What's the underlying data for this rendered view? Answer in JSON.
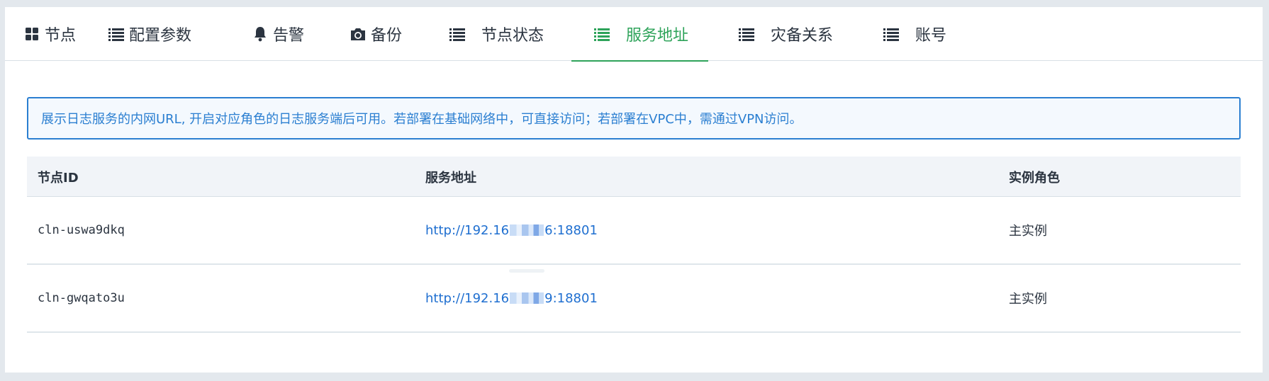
{
  "tabs": [
    {
      "label": "节点",
      "icon": "grid-icon",
      "active": false
    },
    {
      "label": "配置参数",
      "icon": "list-icon",
      "active": false
    },
    {
      "label": "告警",
      "icon": "bell-icon",
      "active": false
    },
    {
      "label": "备份",
      "icon": "camera-icon",
      "active": false
    },
    {
      "label": "节点状态",
      "icon": "list-icon",
      "active": false
    },
    {
      "label": "服务地址",
      "icon": "list-icon",
      "active": true
    },
    {
      "label": "灾备关系",
      "icon": "list-icon",
      "active": false
    },
    {
      "label": "账号",
      "icon": "list-icon",
      "active": false
    }
  ],
  "colors": {
    "accent": "#2ea35a",
    "info": "#2b7fd1",
    "link": "#1f6fd0"
  },
  "notice": "展示日志服务的内网URL, 开启对应角色的日志服务端后可用。若部署在基础网络中，可直接访问；若部署在VPC中，需通过VPN访问。",
  "table": {
    "headers": [
      "节点ID",
      "服务地址",
      "实例角色"
    ],
    "rows": [
      {
        "node_id": "cln-uswa9dkq",
        "url_prefix": "http://192.16",
        "url_suffix": "6:18801",
        "role": "主实例"
      },
      {
        "node_id": "cln-gwqato3u",
        "url_prefix": "http://192.16",
        "url_suffix": "9:18801",
        "role": "主实例"
      }
    ]
  }
}
